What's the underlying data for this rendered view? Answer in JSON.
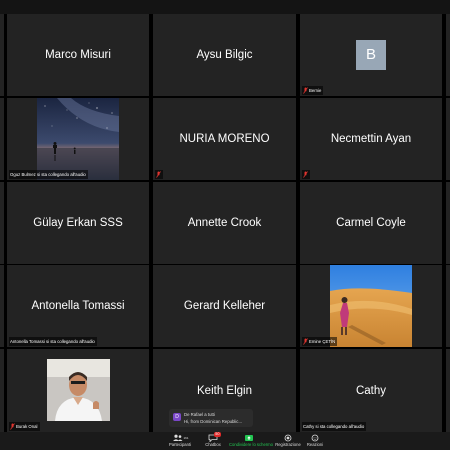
{
  "tiles": {
    "t1": {
      "name": "Marco Misuri"
    },
    "t2": {
      "name": "Aysu Bilgic"
    },
    "t3": {
      "initial": "B",
      "label": "Bernie"
    },
    "t4": {
      "label": "Oguz Bulmez si sta collegando all'audio"
    },
    "t5": {
      "name": "NURIA MORENO"
    },
    "t6": {
      "name": "Necmettin Ayan"
    },
    "t7": {
      "name": "Gülay Erkan SSS"
    },
    "t8": {
      "name": "Annette Crook"
    },
    "t9": {
      "name": "Carmel Coyle"
    },
    "t10": {
      "name": "Antonella Tomassi",
      "label": "Antonella Tomassi si sta collegando all'audio"
    },
    "t11": {
      "name": "Gerard Kelleher"
    },
    "t12": {
      "label": "Emine ÇETİN"
    },
    "t13": {
      "label": "Burak Onal"
    },
    "t14": {
      "name": "Keith Elgin"
    },
    "t15": {
      "name": "Cathy",
      "label": "Cathy si sta collegando all'audio"
    }
  },
  "chat_popup": {
    "avatar": "D",
    "sender": "De Rafael a tutti",
    "message": "Hi, from Dominican Republic..."
  },
  "toolbar": {
    "participants": {
      "label": "Partecipanti",
      "count": "161"
    },
    "chat": {
      "label": "Chatbox",
      "badge": "50"
    },
    "share": {
      "label": "Condividere lo schermo"
    },
    "record": {
      "label": "Registrazione"
    },
    "reactions": {
      "label": "Reazioni"
    }
  },
  "colors": {
    "tile": "#232323",
    "share_green": "#23c552",
    "badge_red": "#e02a2a",
    "muted_red": "#e0352f"
  }
}
